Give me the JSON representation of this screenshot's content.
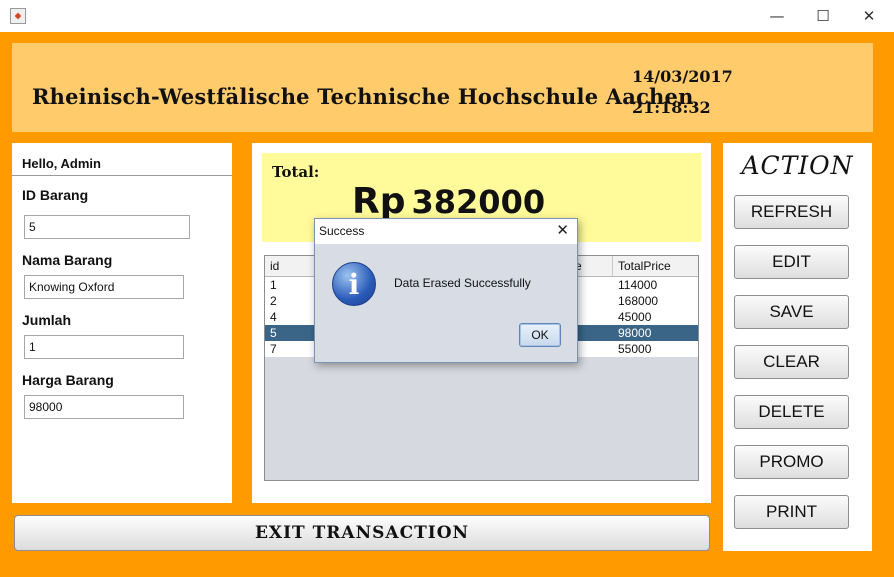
{
  "window": {
    "buttons": {
      "minimize": "—",
      "maximize": "☐",
      "close": "✕"
    }
  },
  "banner": {
    "school": "Rheinisch-Westfälische Technische Hochschule Aachen",
    "date": "14/03/2017",
    "time": "21:18:32"
  },
  "form": {
    "greeting": "Hello, Admin",
    "fields": [
      {
        "label": "ID Barang",
        "value": "5"
      },
      {
        "label": "Nama Barang",
        "value": "Knowing Oxford"
      },
      {
        "label": "Jumlah",
        "value": "1"
      },
      {
        "label": "Harga Barang",
        "value": "98000"
      }
    ]
  },
  "total": {
    "label": "Total:",
    "currency": "Rp",
    "amount": "382000"
  },
  "table": {
    "columns": [
      "id",
      "e",
      "TotalPrice"
    ],
    "rows": [
      {
        "id": "1",
        "total": "114000",
        "selected": false
      },
      {
        "id": "2",
        "total": "168000",
        "selected": false
      },
      {
        "id": "4",
        "total": "45000",
        "selected": false
      },
      {
        "id": "5",
        "total": "98000",
        "selected": true
      },
      {
        "id": "7",
        "total": "55000",
        "selected": false
      }
    ]
  },
  "actions": {
    "title": "ACTION",
    "buttons": [
      "REFRESH",
      "EDIT",
      "SAVE",
      "CLEAR",
      "DELETE",
      "PROMO",
      "PRINT"
    ]
  },
  "exit_label": "EXIT TRANSACTION",
  "dialog": {
    "title": "Success",
    "close": "✕",
    "icon": "info-icon",
    "icon_glyph": "i",
    "message": "Data Erased Successfully",
    "ok": "OK"
  },
  "colors": {
    "frame": "#ff9a00",
    "banner": "#ffcb6b",
    "total_box": "#fffa9a",
    "selected_row": "#3a6587"
  }
}
